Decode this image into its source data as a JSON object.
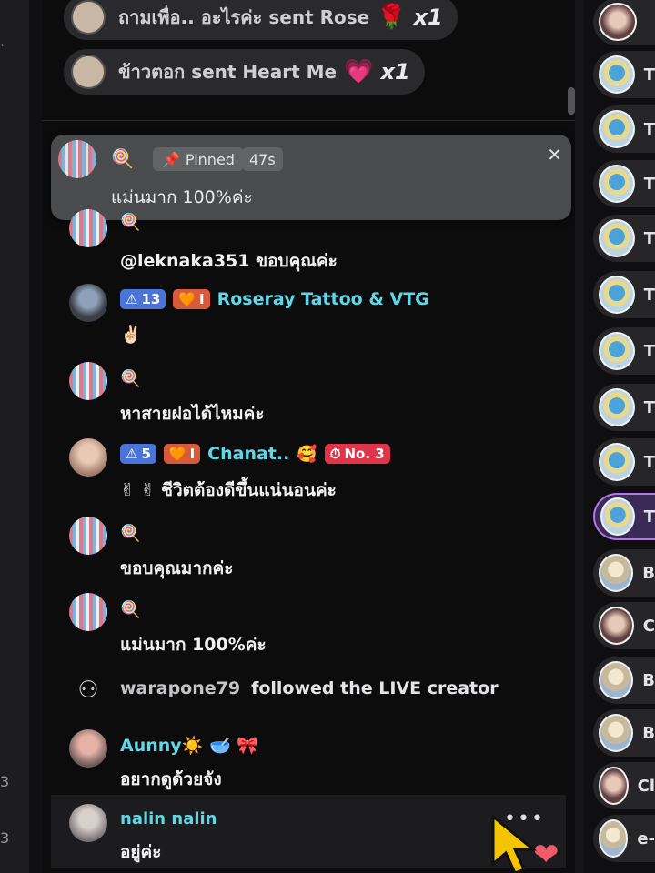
{
  "gifts": [
    {
      "text": "ถามเพื่อ.. อะไรค่ะ sent Rose",
      "icon": "🌹",
      "multiplier": "x1"
    },
    {
      "text": "ข้าวตอก sent Heart Me",
      "icon": "💗",
      "multiplier": "x1"
    }
  ],
  "pinned": {
    "badge_label": "Pinned",
    "time": "47s",
    "message": "แม่นมาก 100%ค่ะ",
    "close_symbol": "✕"
  },
  "comments": [
    {
      "body": "@leknaka351 ขอบคุณค่ะ"
    },
    {
      "level": "13",
      "fan_level": "I",
      "username": "Roseray Tattoo & VTG",
      "body": "✌🏻"
    },
    {
      "body": "หาสายฝอได้ไหมค่ะ"
    },
    {
      "level": "5",
      "fan_level": "I",
      "username": "Chanat..",
      "rank": "No. 3",
      "body": "✌ ✌ ชีวิตต้องดีขึ้นแน่นอนค่ะ"
    },
    {
      "body": "ขอบคุณมากค่ะ"
    },
    {
      "body": "แม่นมาก 100%ค่ะ"
    },
    {
      "username": "Aunny☀️ 🥣 🎀",
      "body": "อยากดูด้วยจัง"
    },
    {
      "username": "nalin nalin",
      "body": "อยู่ค่ะ"
    }
  ],
  "follow_event": {
    "username": "warapone79",
    "text": "followed the LIVE creator"
  },
  "more_label": "•••",
  "viewers": [
    {
      "label": "T"
    },
    {
      "label": "T"
    },
    {
      "label": "T"
    },
    {
      "label": "T"
    },
    {
      "label": "T"
    },
    {
      "label": "T"
    },
    {
      "label": "T"
    },
    {
      "label": "T"
    },
    {
      "label": "T"
    },
    {
      "label": "B"
    },
    {
      "label": "C"
    },
    {
      "label": "B"
    },
    {
      "label": "B"
    },
    {
      "label": "Cl"
    },
    {
      "label": "e-"
    }
  ],
  "left_marks": [
    "-",
    "3",
    "3"
  ]
}
